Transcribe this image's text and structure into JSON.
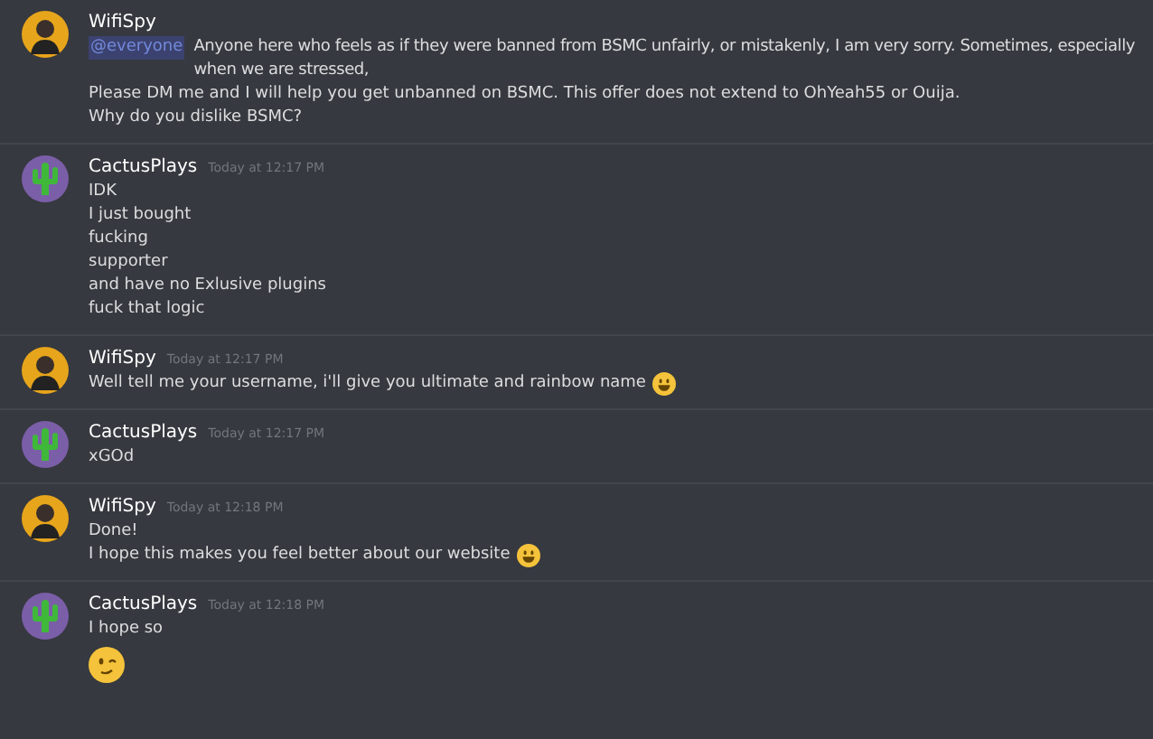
{
  "messages": [
    {
      "author": "WifiSpy",
      "avatar": {
        "kind": "person"
      },
      "mention": "@everyone",
      "lines": [
        {
          "text": "Anyone here who feels as if they were banned from BSMC unfairly, or mistakenly, I am very sorry. Sometimes, especially when we are stressed,"
        },
        {
          "text": "Please DM me and I will help you get unbanned on BSMC. This offer does not extend to OhYeah55 or Ouija."
        },
        {
          "text": "Why do you dislike BSMC?"
        }
      ]
    },
    {
      "author": "CactusPlays",
      "avatar": {
        "kind": "cactus"
      },
      "time": "Today at 12:17 PM",
      "lines": [
        {
          "text": "IDK"
        },
        {
          "text": "I just bought"
        },
        {
          "text": "fucking"
        },
        {
          "text": "supporter"
        },
        {
          "text": "and have no Exlusive plugins"
        },
        {
          "text": "fuck that logic"
        }
      ]
    },
    {
      "author": "WifiSpy",
      "avatar": {
        "kind": "person"
      },
      "time": "Today at 12:17 PM",
      "lines": [
        {
          "text": "Well tell me your username, i'll give you ultimate and rainbow name",
          "emoji": {
            "kind": "smile"
          }
        }
      ]
    },
    {
      "author": "CactusPlays",
      "avatar": {
        "kind": "cactus"
      },
      "time": "Today at 12:17 PM",
      "lines": [
        {
          "text": "xGOd"
        }
      ]
    },
    {
      "author": "WifiSpy",
      "avatar": {
        "kind": "person"
      },
      "time": "Today at 12:18 PM",
      "lines": [
        {
          "text": "Done!"
        },
        {
          "text": "I hope this makes you feel better about our website",
          "emoji": {
            "kind": "smile"
          }
        }
      ]
    },
    {
      "author": "CactusPlays",
      "avatar": {
        "kind": "cactus"
      },
      "time": "Today at 12:18 PM",
      "lines": [
        {
          "text": "I hope so"
        },
        {
          "emoji": {
            "kind": "wink"
          }
        }
      ]
    }
  ]
}
